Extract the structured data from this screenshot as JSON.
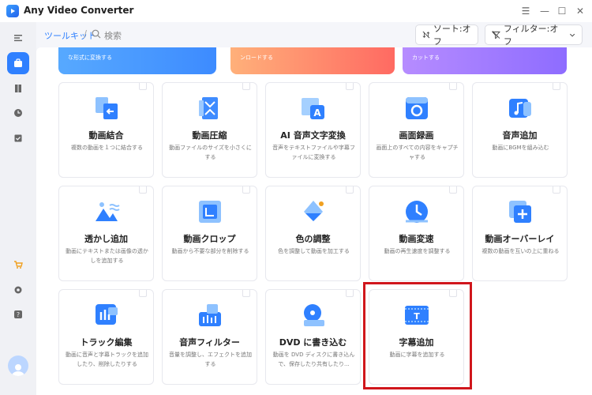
{
  "app": {
    "title": "Any Video Converter"
  },
  "window": {
    "minimize": "—",
    "maximize": "☐",
    "close": "✕",
    "menu": "☰"
  },
  "topbar": {
    "breadcrumb": "ツールキット",
    "separator": "/",
    "search_label": "検索",
    "sort_label": "ソート:オフ",
    "filter_label": "フィルター:オフ"
  },
  "banners": [
    {
      "text": "な形式に変換する"
    },
    {
      "text": "ンロードする"
    },
    {
      "text": "カットする"
    }
  ],
  "cards": [
    {
      "title": "動画結合",
      "desc": "複数の動画を１つに結合する",
      "icon": "merge-icon"
    },
    {
      "title": "動画圧縮",
      "desc": "動画ファイルのサイズを小さくにする",
      "icon": "compress-icon"
    },
    {
      "title": "AI 音声文字変換",
      "desc": "音声をテキストファイルや字幕ファイルに変換する",
      "icon": "transcribe-icon"
    },
    {
      "title": "画面録画",
      "desc": "画面上のすべての内容をキャプチャする",
      "icon": "screen-record-icon"
    },
    {
      "title": "音声追加",
      "desc": "動画にBGMを組み込む",
      "icon": "add-audio-icon"
    },
    {
      "title": "透かし追加",
      "desc": "動画にテキストまたは画像の透かしを追加する",
      "icon": "watermark-icon"
    },
    {
      "title": "動画クロップ",
      "desc": "動画から不要な部分を削除する",
      "icon": "crop-icon"
    },
    {
      "title": "色の調整",
      "desc": "色を調整して動画を加工する",
      "icon": "color-adjust-icon"
    },
    {
      "title": "動画変速",
      "desc": "動画の再生速度を調整する",
      "icon": "speed-icon"
    },
    {
      "title": "動画オーバーレイ",
      "desc": "複数の動画を互いの上に重ねる",
      "icon": "overlay-icon"
    },
    {
      "title": "トラック編集",
      "desc": "動画に音声と字幕トラックを追加したり、削除したりする",
      "icon": "track-edit-icon"
    },
    {
      "title": "音声フィルター",
      "desc": "音量を調整し、エフェクトを追加する",
      "icon": "audio-filter-icon"
    },
    {
      "title": "DVD に書き込む",
      "desc": "動画を DVD ディスクに書き込んで、保存したり共有したり...",
      "icon": "dvd-burn-icon"
    },
    {
      "title": "字幕追加",
      "desc": "動画に字幕を追加する",
      "icon": "subtitle-icon"
    }
  ],
  "colors": {
    "accent": "#2f80ff",
    "highlight": "#d0161c"
  }
}
